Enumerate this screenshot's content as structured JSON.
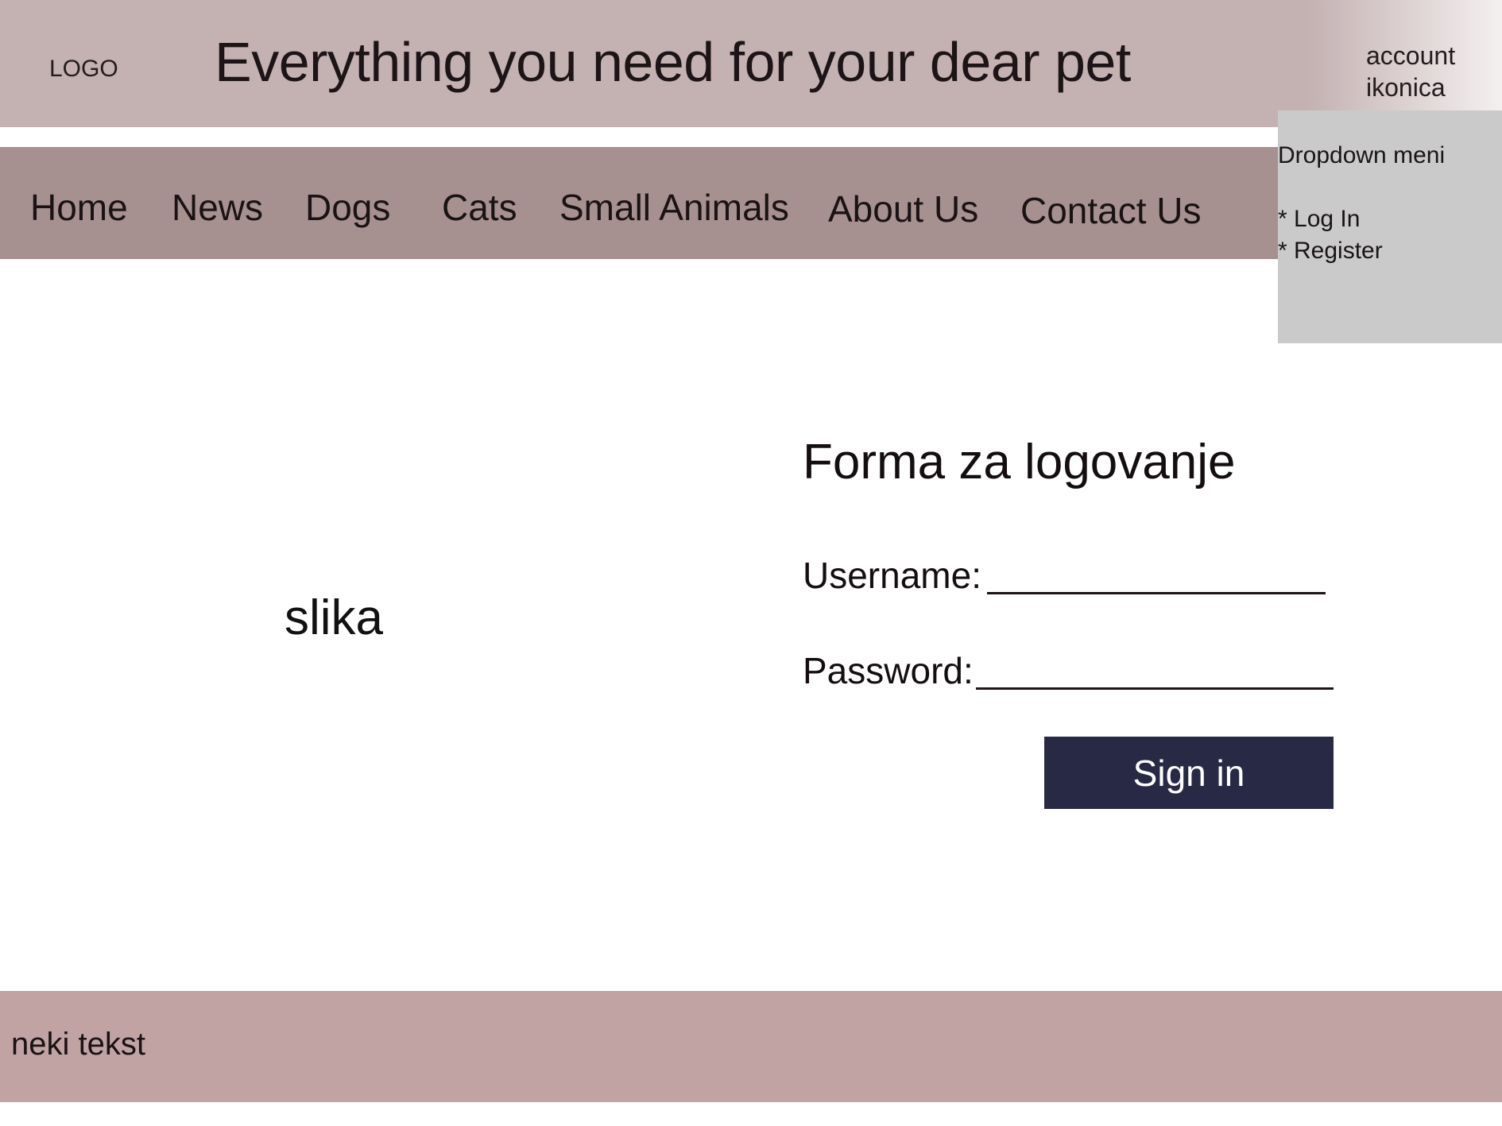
{
  "header": {
    "logo": "LOGO",
    "title": "Everything you need for your dear pet",
    "account_line1": "account",
    "account_line2": "ikonica"
  },
  "nav": {
    "items": [
      "Home",
      "News",
      "Dogs",
      "Cats",
      "Small Animals",
      "About Us",
      "Contact Us"
    ]
  },
  "dropdown": {
    "title": "Dropdown meni",
    "items": [
      "* Log In",
      "* Register"
    ]
  },
  "main": {
    "image_placeholder": "slika",
    "form": {
      "title": "Forma za logovanje",
      "username_label": "Username:",
      "username_value": "",
      "password_label": "Password:",
      "password_value": "",
      "submit_label": "Sign in"
    }
  },
  "footer": {
    "text": "neki tekst"
  },
  "colors": {
    "header_bg": "#c4b1b2",
    "nav_bg": "#a69190",
    "dropdown_bg": "#cacaca",
    "button_bg": "#282a45",
    "footer_bg": "#c1a3a4"
  }
}
